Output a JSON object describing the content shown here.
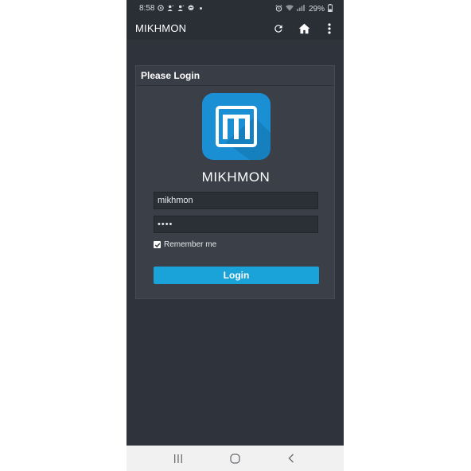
{
  "status_bar": {
    "time": "8:58",
    "battery": "29%",
    "left_icons": [
      "whatsapp-icon",
      "person-icon",
      "person-icon",
      "messenger-icon"
    ],
    "right_icons": [
      "alarm-icon",
      "wifi-icon",
      "signal-icon",
      "battery-icon"
    ]
  },
  "app_bar": {
    "title": "MIKHMON",
    "actions": [
      "refresh-icon",
      "home-icon",
      "more-vert-icon"
    ]
  },
  "login_card": {
    "header": "Please Login",
    "brand": "MIKHMON",
    "username_value": "mikhmon",
    "password_value": "••••",
    "remember_label": "Remember me",
    "remember_checked": true,
    "login_label": "Login"
  },
  "colors": {
    "accent": "#1aa3d8",
    "logo_bg": "#1b8fd4",
    "page_bg": "#2f343c",
    "card_bg": "#3a3f48"
  },
  "nav_bar": {
    "buttons": [
      "recents-icon",
      "home-button-icon",
      "back-icon"
    ]
  }
}
